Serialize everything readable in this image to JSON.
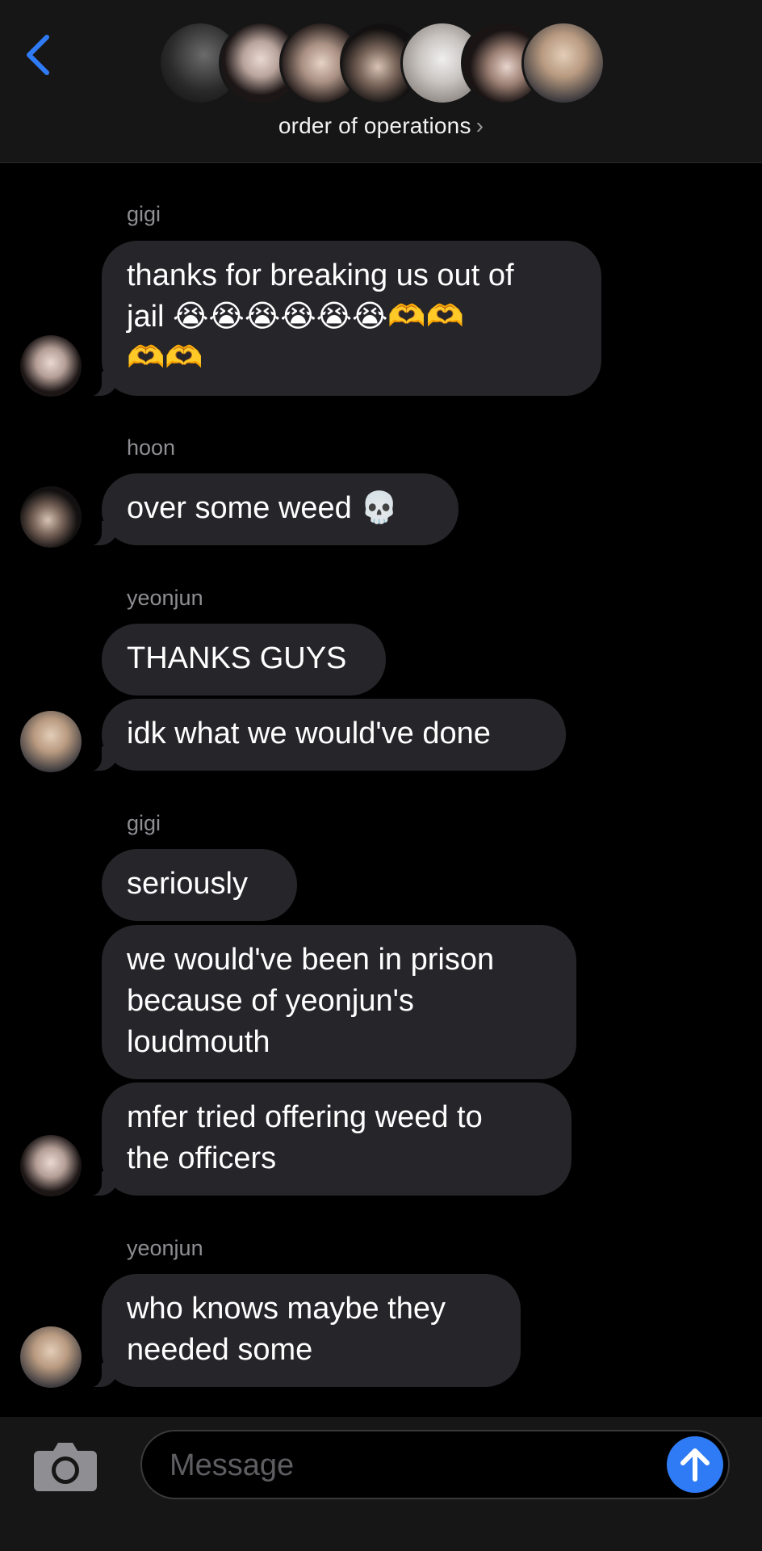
{
  "header": {
    "group_name": "order of operations",
    "chevron": "›",
    "back_icon": "chevron-left-icon",
    "member_avatars": [
      "avatar-1",
      "avatar-2",
      "avatar-3",
      "avatar-4",
      "avatar-5",
      "avatar-6",
      "avatar-7"
    ]
  },
  "messages": [
    {
      "sender": "gigi",
      "bubbles": [
        "thanks for breaking us out of\njail 😭😭😭😭😭😭🫶🫶\n🫶🫶"
      ]
    },
    {
      "sender": "hoon",
      "bubbles": [
        "over some weed 💀"
      ]
    },
    {
      "sender": "yeonjun",
      "bubbles": [
        "THANKS GUYS",
        "idk what we would've done"
      ]
    },
    {
      "sender": "gigi",
      "bubbles": [
        "seriously",
        "we would've been in prison\nbecause of yeonjun's\nloudmouth",
        "mfer tried offering weed to\nthe officers"
      ]
    },
    {
      "sender": "yeonjun",
      "bubbles": [
        "who knows maybe they\nneeded some"
      ]
    }
  ],
  "input": {
    "placeholder": "Message",
    "value": ""
  },
  "colors": {
    "accent": "#2f7bf5",
    "bubble": "#26252a",
    "background": "#000000",
    "header_bg": "#161616",
    "sender_label": "#8e8e93"
  }
}
